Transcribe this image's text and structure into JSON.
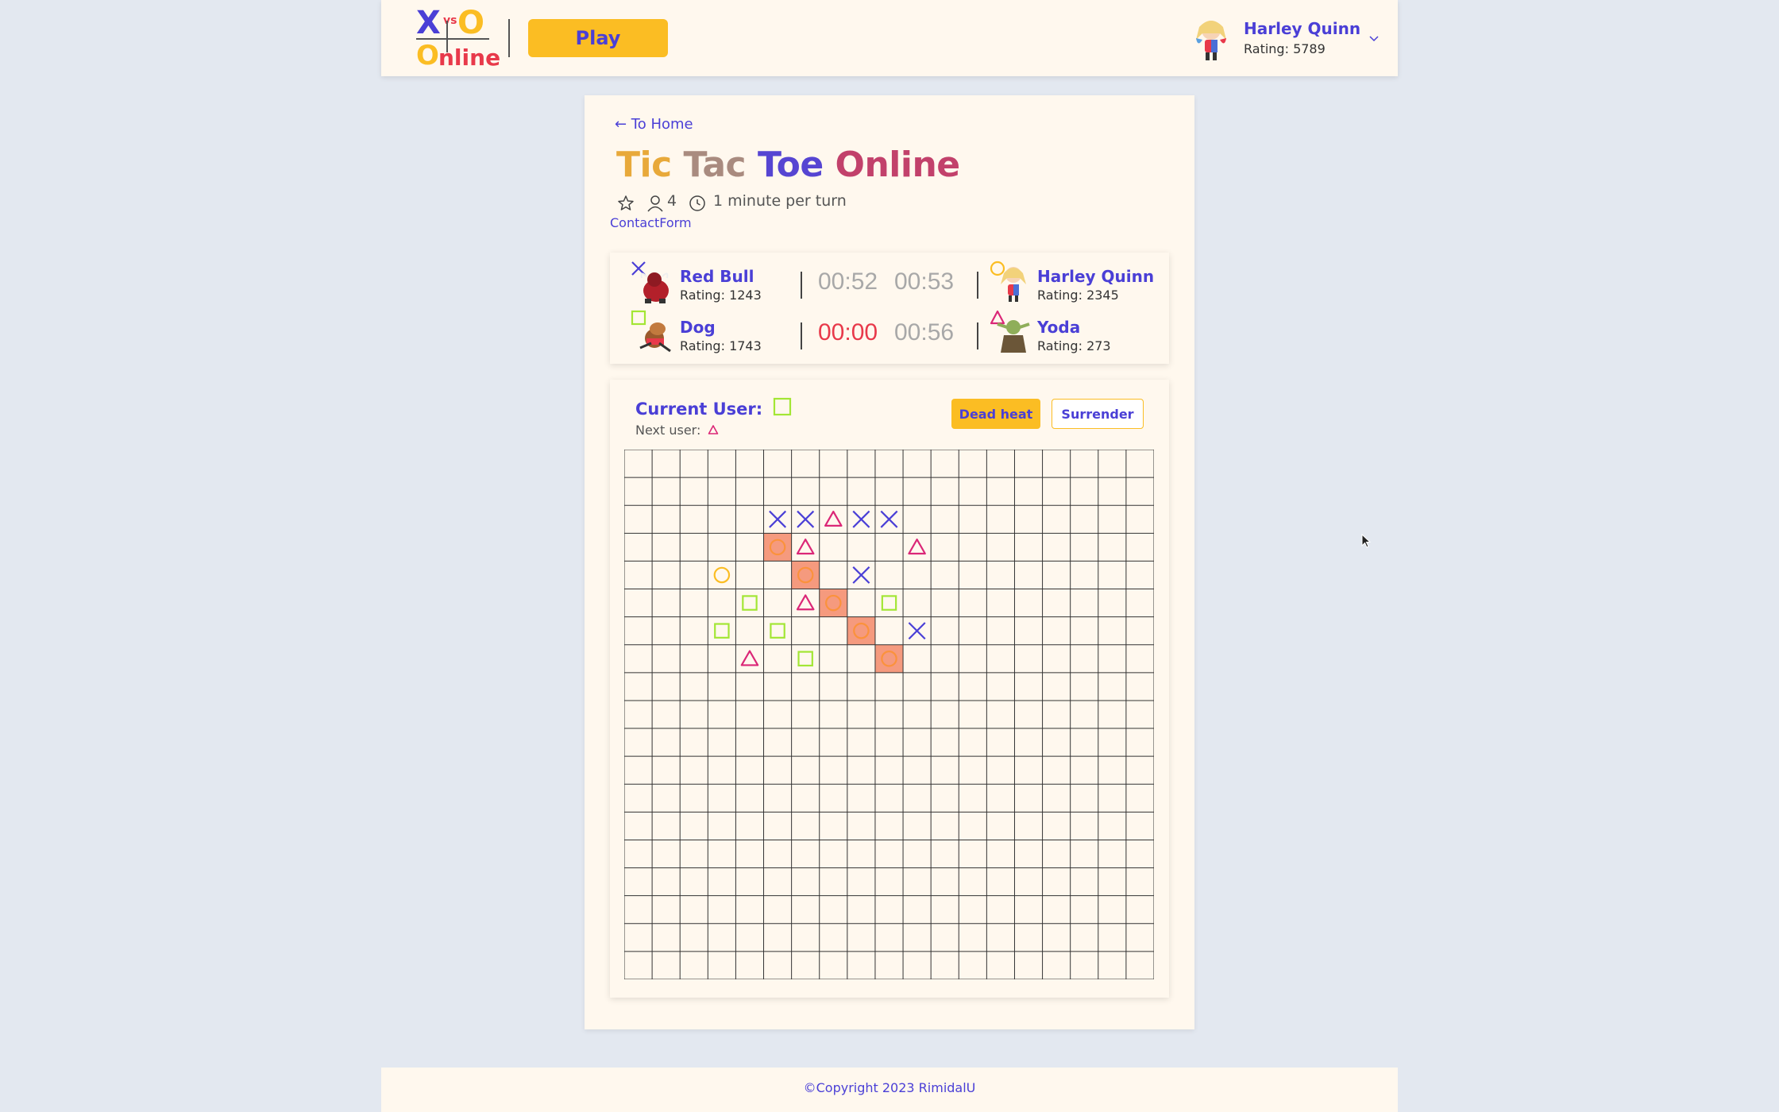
{
  "header": {
    "logo": {
      "x": "X",
      "vs": "vs",
      "o": "O",
      "o2": "O",
      "nline": "nline"
    },
    "play_label": "Play",
    "user": {
      "name": "Harley Quinn",
      "rating": "Rating: 5789"
    }
  },
  "main": {
    "back_label": "← To Home",
    "title_words": [
      "Tic",
      "Tac",
      "Toe",
      "Online"
    ],
    "meta": {
      "players_count": "4",
      "turn_time": "1 minute per turn"
    },
    "contact_label": "ContactForm"
  },
  "players": [
    {
      "symbol": "cross",
      "name": "Red Bull",
      "rating": "Rating: 1243",
      "timer": "00:52",
      "timer_color": "#a8a8a8"
    },
    {
      "symbol": "circle",
      "name": "Harley Quinn",
      "rating": "Rating: 2345",
      "timer": "00:53",
      "timer_color": "#a8a8a8"
    },
    {
      "symbol": "square",
      "name": "Dog",
      "rating": "Rating: 1743",
      "timer": "00:00",
      "timer_color": "#e8394a"
    },
    {
      "symbol": "triangle",
      "name": "Yoda",
      "rating": "Rating: 273",
      "timer": "00:56",
      "timer_color": "#a8a8a8"
    }
  ],
  "game": {
    "current_user_label": "Current User:",
    "current_symbol": "square",
    "next_user_label": "Next user:",
    "next_symbol": "triangle",
    "dead_heat_label": "Dead heat",
    "surrender_label": "Surrender"
  },
  "board": {
    "size": 19,
    "cells": [
      {
        "row": 2,
        "col": 5,
        "s": "x"
      },
      {
        "row": 2,
        "col": 6,
        "s": "x"
      },
      {
        "row": 2,
        "col": 7,
        "s": "t"
      },
      {
        "row": 2,
        "col": 8,
        "s": "x"
      },
      {
        "row": 2,
        "col": 9,
        "s": "x"
      },
      {
        "row": 3,
        "col": 5,
        "s": "o",
        "win": true
      },
      {
        "row": 3,
        "col": 6,
        "s": "t"
      },
      {
        "row": 3,
        "col": 10,
        "s": "t"
      },
      {
        "row": 4,
        "col": 3,
        "s": "o"
      },
      {
        "row": 4,
        "col": 6,
        "s": "o",
        "win": true
      },
      {
        "row": 4,
        "col": 8,
        "s": "x"
      },
      {
        "row": 5,
        "col": 4,
        "s": "s"
      },
      {
        "row": 5,
        "col": 6,
        "s": "t"
      },
      {
        "row": 5,
        "col": 7,
        "s": "o",
        "win": true
      },
      {
        "row": 5,
        "col": 9,
        "s": "s"
      },
      {
        "row": 6,
        "col": 3,
        "s": "s"
      },
      {
        "row": 6,
        "col": 5,
        "s": "s"
      },
      {
        "row": 6,
        "col": 8,
        "s": "o",
        "win": true
      },
      {
        "row": 6,
        "col": 10,
        "s": "x"
      },
      {
        "row": 7,
        "col": 4,
        "s": "t"
      },
      {
        "row": 7,
        "col": 6,
        "s": "s"
      },
      {
        "row": 7,
        "col": 9,
        "s": "o",
        "win": true
      }
    ]
  },
  "colors": {
    "cross": "#4a3fd6",
    "circle": "#fbbd23",
    "square": "#a3e635",
    "triangle": "#db2777",
    "win_bg": "#f59a7e",
    "win_mark": "#fb923c",
    "accent": "#4a3fd6",
    "play": "#fbbd23"
  },
  "footer": {
    "copyright": "©Copyright 2023 RimidalU"
  }
}
